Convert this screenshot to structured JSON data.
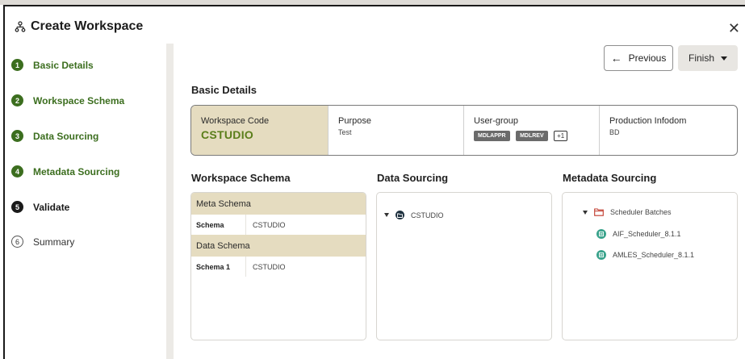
{
  "header": {
    "title": "Create Workspace"
  },
  "steps": [
    {
      "num": "1",
      "label": "Basic Details",
      "state": "done"
    },
    {
      "num": "2",
      "label": "Workspace Schema",
      "state": "done"
    },
    {
      "num": "3",
      "label": "Data Sourcing",
      "state": "done"
    },
    {
      "num": "4",
      "label": "Metadata Sourcing",
      "state": "done"
    },
    {
      "num": "5",
      "label": "Validate",
      "state": "active"
    },
    {
      "num": "6",
      "label": "Summary",
      "state": "todo"
    }
  ],
  "toolbar": {
    "previous_label": "Previous",
    "finish_label": "Finish"
  },
  "basic_details": {
    "title": "Basic Details",
    "workspace_code_label": "Workspace Code",
    "workspace_code": "CSTUDIO",
    "purpose_label": "Purpose",
    "purpose": "Test",
    "user_group_label": "User-group",
    "user_groups": [
      "MDLAPPR",
      "MDLREV"
    ],
    "user_group_more": "+1",
    "production_infodom_label": "Production Infodom",
    "production_infodom": "BD"
  },
  "workspace_schema": {
    "title": "Workspace Schema",
    "meta_schema_label": "Meta Schema",
    "meta_rows": [
      {
        "key": "Schema",
        "value": "CSTUDIO"
      }
    ],
    "data_schema_label": "Data Schema",
    "data_rows": [
      {
        "key": "Schema 1",
        "value": "CSTUDIO"
      }
    ]
  },
  "data_sourcing": {
    "title": "Data Sourcing",
    "items": [
      "CSTUDIO"
    ]
  },
  "metadata_sourcing": {
    "title": "Metadata Sourcing",
    "folder": "Scheduler Batches",
    "items": [
      "AIF_Scheduler_8.1.1",
      "AMLES_Scheduler_8.1.1"
    ]
  },
  "colors": {
    "accent_green": "#3c6e1f",
    "code_green": "#5a7e1a",
    "highlight_beige": "#e5dcc0"
  }
}
